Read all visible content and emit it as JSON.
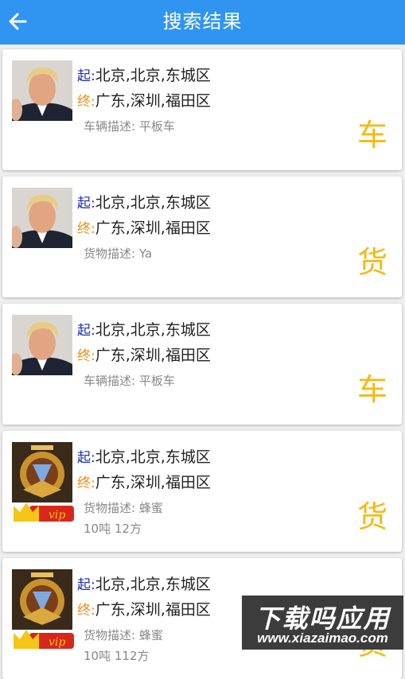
{
  "header": {
    "title": "搜索结果"
  },
  "results": [
    {
      "avatar": "person-photo",
      "from_tag": "起:",
      "from": "北京,北京,东城区",
      "to_tag": "终:",
      "to": "广东,深圳,福田区",
      "desc": "车辆描述: 平板车",
      "load": "",
      "type_mark": "车"
    },
    {
      "avatar": "person-photo",
      "from_tag": "起:",
      "from": "北京,北京,东城区",
      "to_tag": "终:",
      "to": "广东,深圳,福田区",
      "desc": "货物描述: Ya",
      "load": "",
      "type_mark": "货"
    },
    {
      "avatar": "person-photo",
      "from_tag": "起:",
      "from": "北京,北京,东城区",
      "to_tag": "终:",
      "to": "广东,深圳,福田区",
      "desc": "车辆描述: 平板车",
      "load": "",
      "type_mark": "车"
    },
    {
      "avatar": "game-emblem",
      "vip": "vip",
      "from_tag": "起:",
      "from": "北京,北京,东城区",
      "to_tag": "终:",
      "to": "广东,深圳,福田区",
      "desc": "货物描述: 蜂蜜",
      "load": "10吨 12方",
      "type_mark": "货"
    },
    {
      "avatar": "game-emblem",
      "vip": "vip",
      "from_tag": "起:",
      "from": "北京,北京,东城区",
      "to_tag": "终:",
      "to": "广东,深圳,福田区",
      "desc": "货物描述: 蜂蜜",
      "load": "10吨 112方",
      "type_mark": "货"
    }
  ],
  "watermark": {
    "title": "下载吗应用",
    "url": "www.xiazaimao.com"
  },
  "colors": {
    "header": "#2f95f0",
    "from_tag": "#1a2bb8",
    "to_tag": "#f08a12",
    "type_mark": "#f5b914"
  }
}
